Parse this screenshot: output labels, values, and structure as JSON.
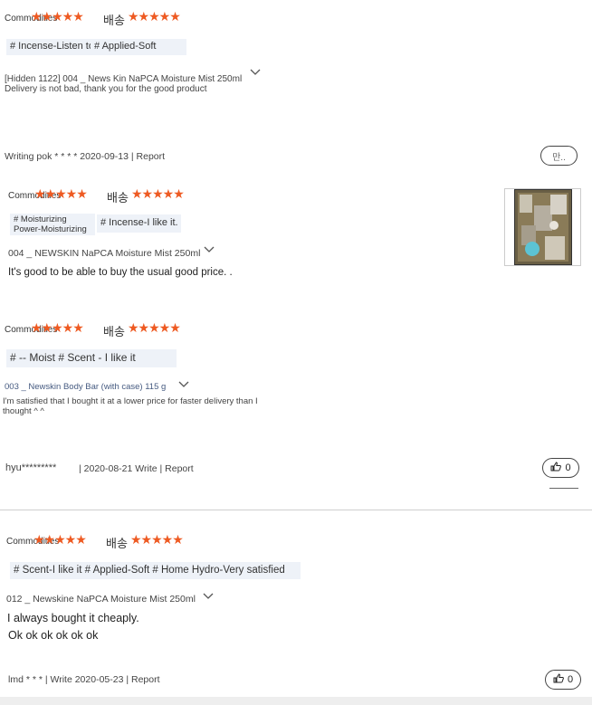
{
  "labels": {
    "commodities": "Commodities",
    "delivery": "배송",
    "stars": "★★★★★"
  },
  "reviews": [
    {
      "tags": [
        "# Incense-Listen to me",
        "# Applied-Soft"
      ],
      "option": "[Hidden 1122] 004 _ News Kin NaPCA Moisture Mist 250ml",
      "text": "Delivery is not bad, thank you for the good product",
      "meta": "Writing pok * * * * 2020-09-13 | Report",
      "like_label": "만.."
    },
    {
      "tags": [
        "# Moisturizing Power-Moisturizing",
        "# Incense-I like it."
      ],
      "option": "004 _ NEWSKIN NaPCA Moisture Mist 250ml",
      "text": "It's good to be able to buy the usual good price. ."
    },
    {
      "tags": [
        "# -- Moist # Scent - I like it"
      ],
      "option": "003 _ Newskin Body Bar (with case) 115 g",
      "text_line1": "I'm satisfied that I bought it at a lower price for faster delivery than I",
      "text_line2": "thought ^ ^",
      "meta_user": "hyu*********",
      "meta": "| 2020-08-21 Write | Report",
      "like_count": "0"
    },
    {
      "tags": [
        "# Scent-I like it # Applied-Soft # Home Hydro-Very satisfied"
      ],
      "option": "012 _ Newskine NaPCA Moisture Mist 250ml",
      "text_line1": "I always bought it cheaply.",
      "text_line2": "Ok ok ok ok ok ok",
      "meta": "lmd * * * | Write 2020-05-23 | Report",
      "like_count": "0"
    }
  ],
  "colors": {
    "star": "#ee5a22",
    "tag_bg": "#eef2f8"
  },
  "icons": {
    "chevron": "chevron-down-icon",
    "thumb": "thumbs-up-icon"
  }
}
